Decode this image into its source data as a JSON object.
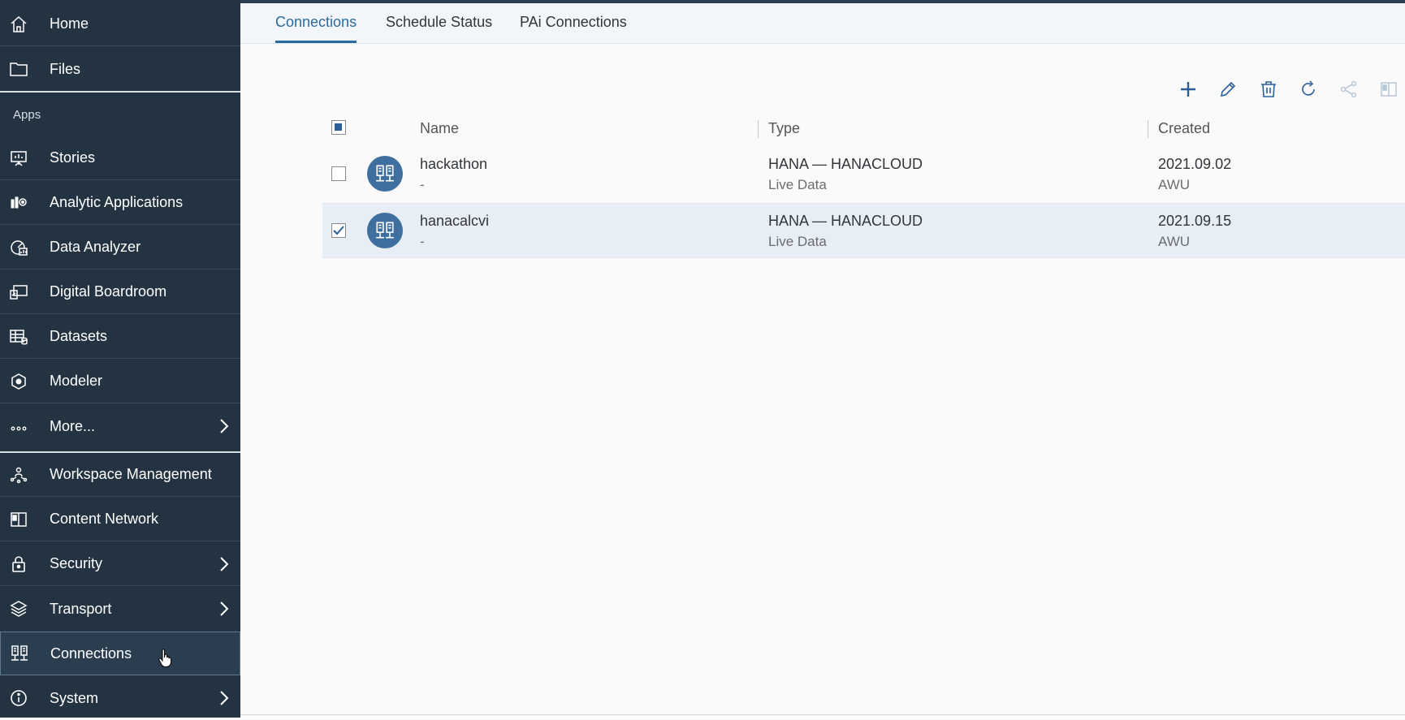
{
  "sidebar": {
    "items_top": [
      {
        "label": "Home",
        "icon": "home-icon"
      },
      {
        "label": "Files",
        "icon": "folder-icon"
      }
    ],
    "apps_header": "Apps",
    "apps": [
      {
        "label": "Stories",
        "icon": "stories-icon"
      },
      {
        "label": "Analytic Applications",
        "icon": "analytic-applications-icon"
      },
      {
        "label": "Data Analyzer",
        "icon": "data-analyzer-icon"
      },
      {
        "label": "Digital Boardroom",
        "icon": "digital-boardroom-icon"
      },
      {
        "label": "Datasets",
        "icon": "datasets-icon"
      },
      {
        "label": "Modeler",
        "icon": "modeler-icon"
      },
      {
        "label": "More...",
        "icon": "more-icon"
      }
    ],
    "system": [
      {
        "label": "Workspace Management",
        "icon": "workspace-icon"
      },
      {
        "label": "Content Network",
        "icon": "content-network-icon"
      },
      {
        "label": "Security",
        "icon": "lock-icon"
      },
      {
        "label": "Transport",
        "icon": "transport-icon"
      },
      {
        "label": "Connections",
        "icon": "connections-icon",
        "active": true
      },
      {
        "label": "System",
        "icon": "info-icon"
      }
    ]
  },
  "tabs": [
    {
      "label": "Connections",
      "selected": true
    },
    {
      "label": "Schedule Status",
      "selected": false
    },
    {
      "label": "PAi Connections",
      "selected": false
    }
  ],
  "toolbar": [
    "add-icon",
    "edit-icon",
    "delete-icon",
    "refresh-icon",
    "share-icon",
    "book-icon"
  ],
  "table": {
    "headers": {
      "name": "Name",
      "type": "Type",
      "created": "Created"
    },
    "rows": [
      {
        "name": "hackathon",
        "desc": "-",
        "type": "HANA — HANACLOUD",
        "subtype": "Live Data",
        "date": "2021.09.02",
        "owner": "AWU",
        "checked": false
      },
      {
        "name": "hanacalcvi",
        "desc": "-",
        "type": "HANA — HANACLOUD",
        "subtype": "Live Data",
        "date": "2021.09.15",
        "owner": "AWU",
        "checked": true
      }
    ]
  },
  "colors": {
    "sidebar_bg": "#233341",
    "accent": "#2a6b9e",
    "icon_circle": "#3f6f9f",
    "selected_row": "#e8eef6"
  }
}
